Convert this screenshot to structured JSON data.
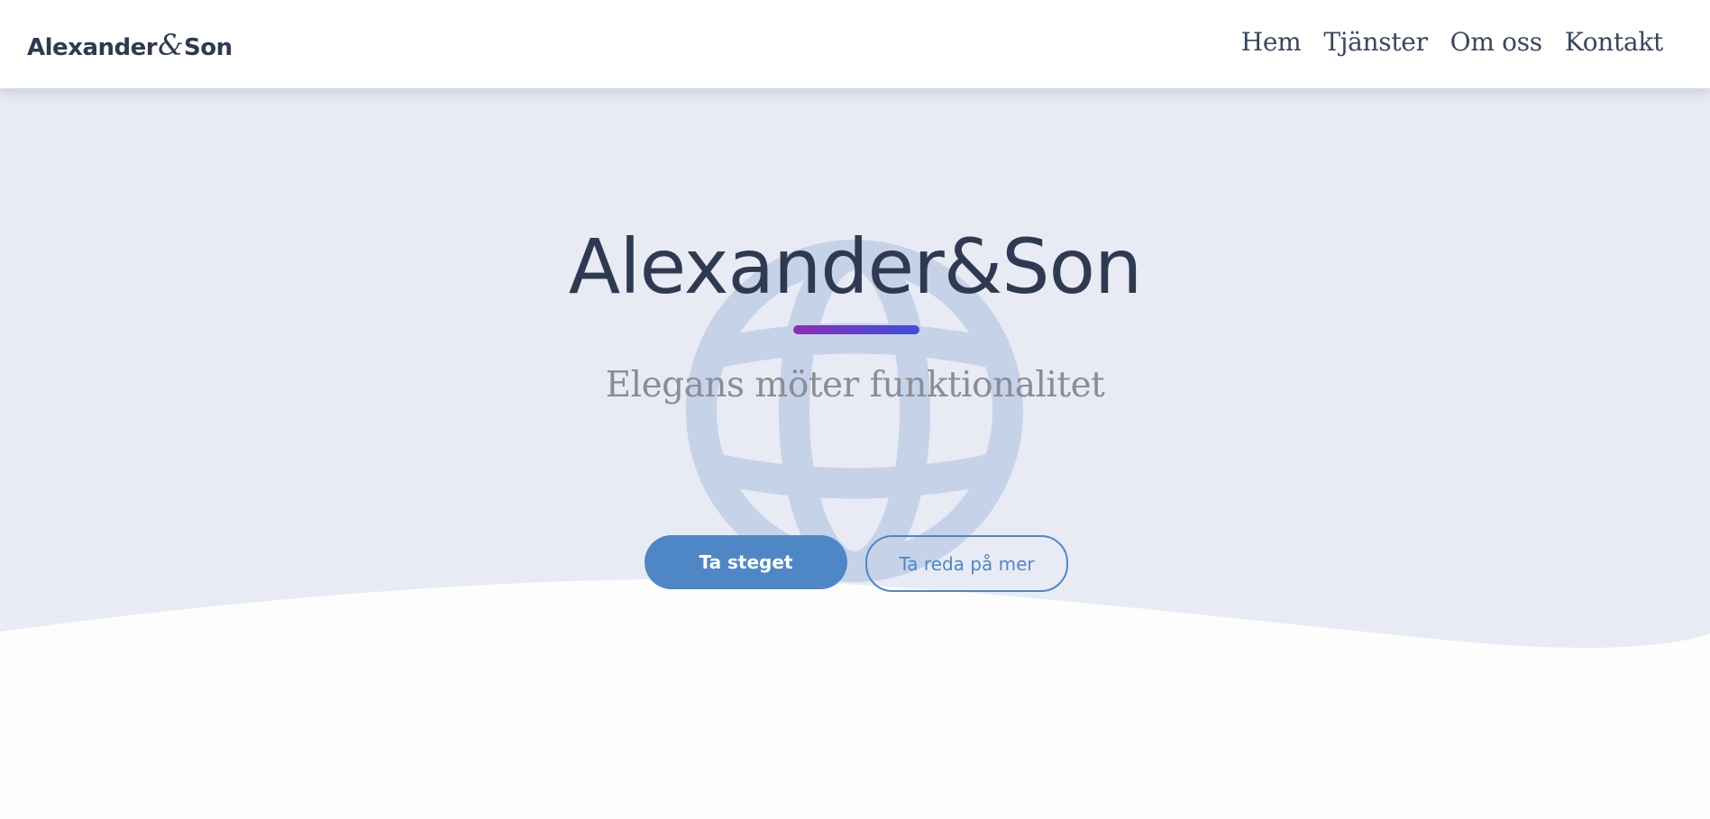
{
  "header": {
    "logo_left": "Alexander",
    "logo_amp": "&",
    "logo_right": "Son",
    "nav": [
      "Hem",
      "Tjänster",
      "Om oss",
      "Kontakt"
    ]
  },
  "hero": {
    "title": "Alexander&Son",
    "tagline": "Elegans möter funktionalitet",
    "primary_button": "Ta steget",
    "secondary_button": "Ta reda på mer"
  },
  "icons": {
    "background_icon": "globe-icon"
  },
  "colors": {
    "hero_background": "#e8ebf4",
    "brand_blue": "#4f87c6",
    "text_dark": "#2f3a52",
    "tagline_gray": "#8a8d95",
    "accent_gradient_start": "#8a30b0",
    "accent_gradient_end": "#3f4ee0",
    "globe_tint": "#c5d2e8"
  }
}
